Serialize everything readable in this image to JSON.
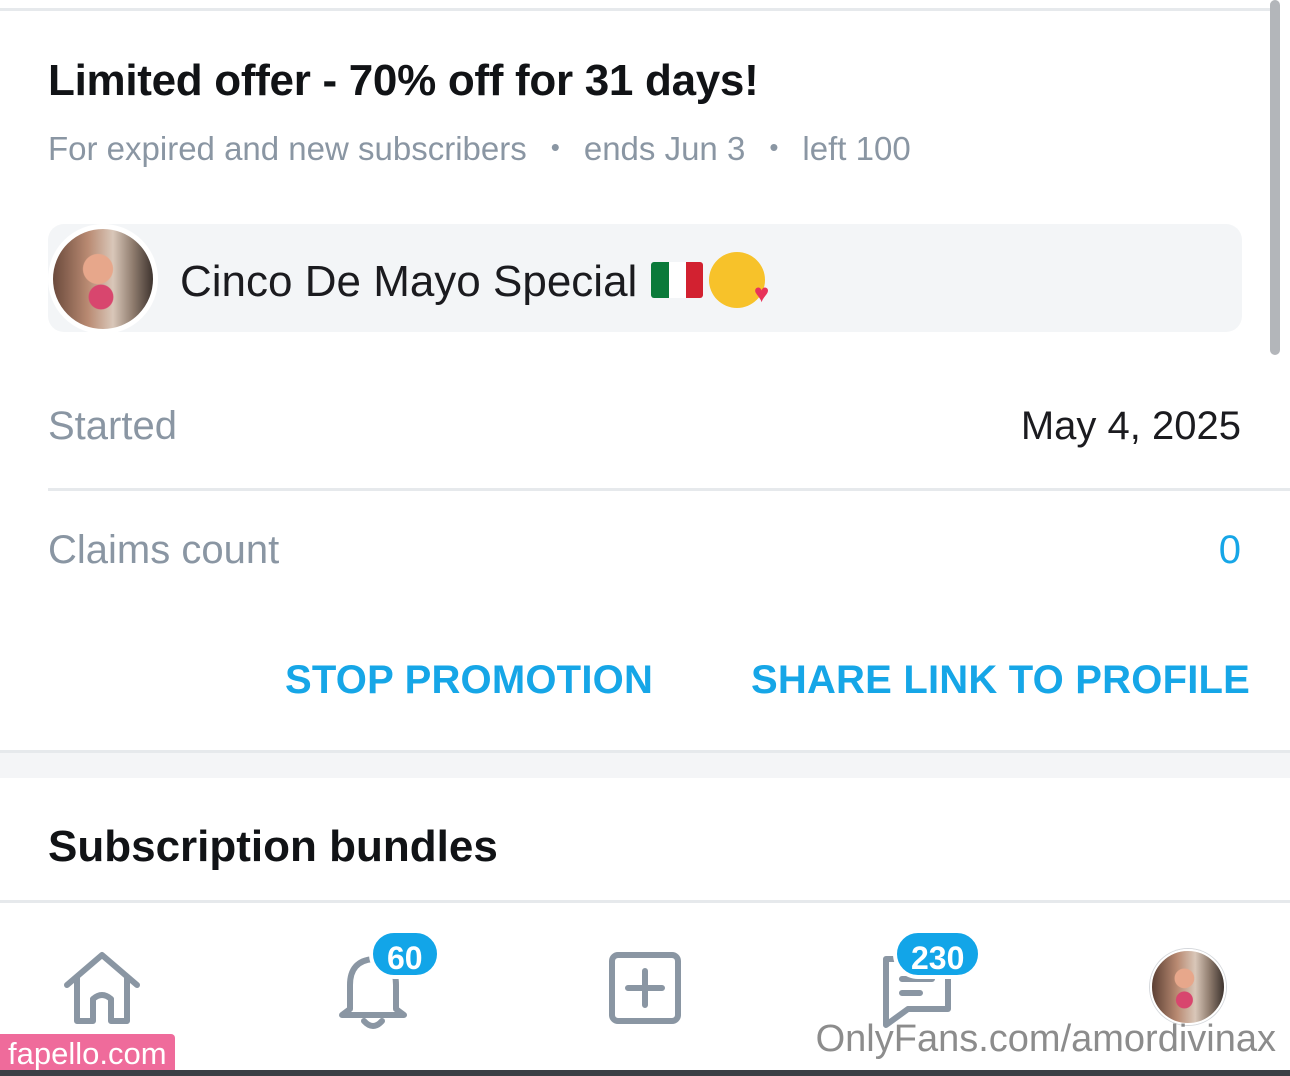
{
  "offer": {
    "title": "Limited offer - 70% off for 31 days!",
    "audience": "For expired and new subscribers",
    "ends": "ends Jun 3",
    "left": "left 100"
  },
  "promo": {
    "name": "Cinco De Mayo Special"
  },
  "stats": {
    "started_label": "Started",
    "started_value": "May 4, 2025",
    "claims_label": "Claims count",
    "claims_value": "0"
  },
  "actions": {
    "stop": "STOP PROMOTION",
    "share": "SHARE LINK TO PROFILE"
  },
  "bundles": {
    "title": "Subscription bundles"
  },
  "nav": {
    "notifications_count": "60",
    "messages_count": "230",
    "items": [
      "home-icon",
      "bell-icon",
      "add-post-icon",
      "message-icon",
      "profile-avatar"
    ]
  },
  "watermarks": {
    "left": "fapello.com",
    "right": "OnlyFans.com/amordivinax"
  },
  "colors": {
    "accent": "#16a6e7",
    "muted": "#8a96a3",
    "badge": "#12a5e8"
  }
}
